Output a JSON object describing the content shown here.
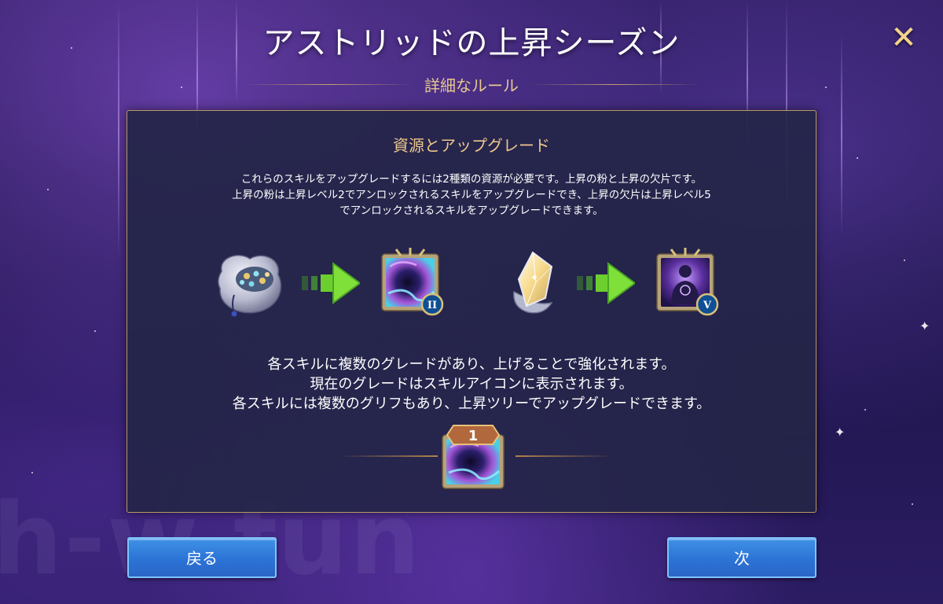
{
  "header": {
    "title": "アストリッドの上昇シーズン",
    "subtitle": "詳細なルール",
    "close_icon": "close-x-icon",
    "accent_color": "#f3d48a"
  },
  "panel": {
    "title": "資源とアップグレード",
    "description_lines": [
      "これらのスキルをアップグレードするには2種類の資源が必要です。上昇の粉と上昇の欠片です。",
      "上昇の粉は上昇レベル2でアンロックされるスキルをアップグレードでき、上昇の欠片は上昇レベル5",
      "でアンロックされるスキルをアップグレードできます。"
    ],
    "upgrade_flow": [
      {
        "resource": "powder-bag-icon",
        "arrow": "green-arrow-icon",
        "skill": "vortex-skill-icon",
        "badge": "II"
      },
      {
        "resource": "crystal-shard-icon",
        "arrow": "green-arrow-icon",
        "skill": "silhouette-skill-icon",
        "badge": "V"
      }
    ],
    "paragraph_lines": [
      "各スキルに複数のグレードがあり、上げることで強化されます。",
      "現在のグレードはスキルアイコンに表示されます。",
      "各スキルには複数のグリフもあり、上昇ツリーでアップグレードできます。"
    ],
    "grade_example": {
      "badge": "1",
      "skill": "vortex-skill-icon"
    }
  },
  "footer": {
    "back_label": "戻る",
    "next_label": "次",
    "button_color": "#2c73d6"
  },
  "watermark": "h-w.fun"
}
